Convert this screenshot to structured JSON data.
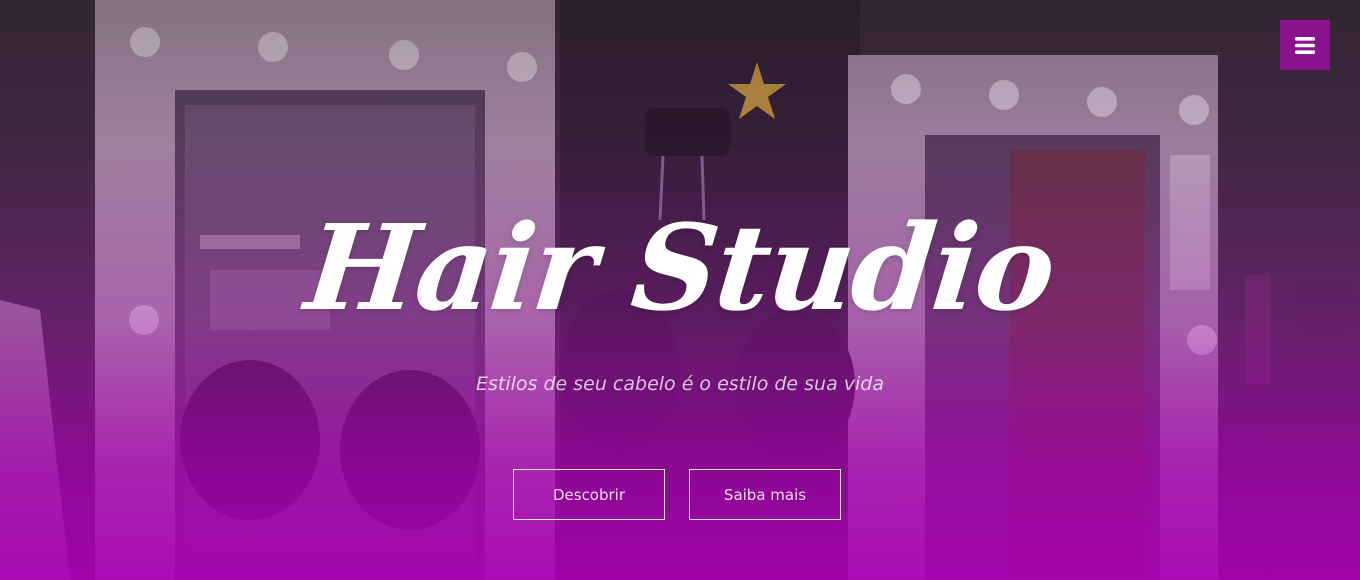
{
  "hero": {
    "title": "Hair Studio",
    "subtitle": "Estilos de seu cabelo é o estilo de sua vida",
    "buttons": {
      "discover_label": "Descobrir",
      "more_label": "Saiba mais"
    },
    "background_image": "hair-salon-mirrors"
  },
  "nav": {
    "menu_icon": "hamburger-menu-icon"
  },
  "colors": {
    "accent": "#8a1290",
    "overlay_bottom": "#aa00b4",
    "text": "#ffffff"
  }
}
